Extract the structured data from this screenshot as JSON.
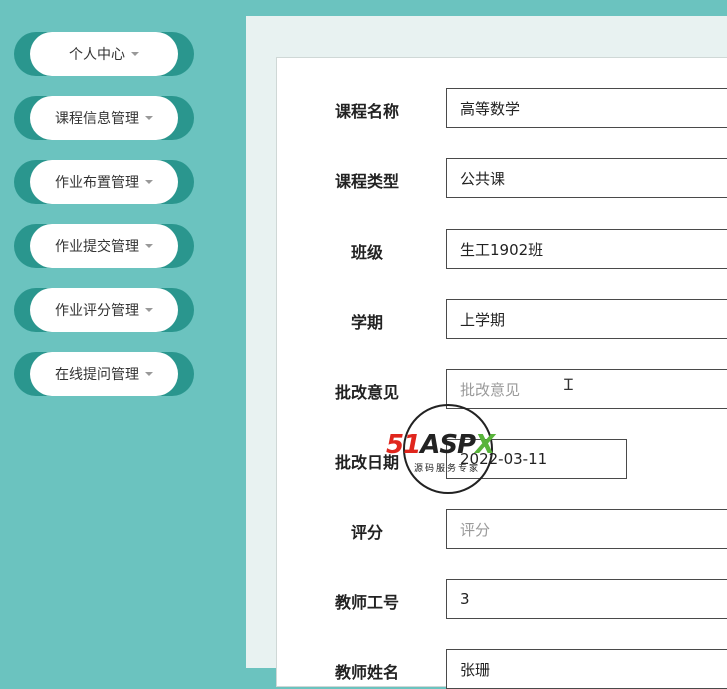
{
  "sidebar": {
    "items": [
      {
        "label": "个人中心"
      },
      {
        "label": "课程信息管理"
      },
      {
        "label": "作业布置管理"
      },
      {
        "label": "作业提交管理"
      },
      {
        "label": "作业评分管理"
      },
      {
        "label": "在线提问管理"
      }
    ]
  },
  "form": {
    "course_name": {
      "label": "课程名称",
      "value": "高等数学"
    },
    "course_type": {
      "label": "课程类型",
      "value": "公共课"
    },
    "class": {
      "label": "班级",
      "value": "生工1902班"
    },
    "semester": {
      "label": "学期",
      "value": "上学期"
    },
    "review_comment": {
      "label": "批改意见",
      "placeholder": "批改意见"
    },
    "review_date": {
      "label": "批改日期",
      "value": "2022-03-11"
    },
    "score": {
      "label": "评分",
      "placeholder": "评分"
    },
    "teacher_id": {
      "label": "教师工号",
      "value": "3"
    },
    "teacher_name": {
      "label": "教师姓名",
      "value": "张珊"
    }
  },
  "watermark": {
    "brand_51": "51",
    "brand_a": "A",
    "brand_sp": "SP",
    "brand_x": "X",
    "sub": "源码服务专家"
  },
  "icons": {
    "caret": "chevron-down-icon",
    "cursor": "text-cursor-icon"
  },
  "colors": {
    "sidebar_bg": "#6bc3bf",
    "menu_accent": "#2a968e",
    "main_bg": "#e8f2f1"
  }
}
